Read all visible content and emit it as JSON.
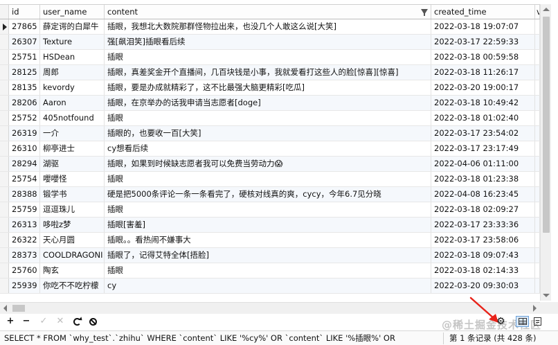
{
  "columns": {
    "id": "id",
    "user_name": "user_name",
    "content": "content",
    "created_time": "created_time",
    "extra": "v"
  },
  "rows": [
    {
      "id": "27865",
      "user_name": "薛定谔的白犀牛",
      "content": "插眼，我想北大数院那群怪物拉出来，也没几个人敢这么说[大笑]",
      "created_time": "2022-03-18 19:07:07"
    },
    {
      "id": "26307",
      "user_name": "Texture",
      "content": "强[飙泪笑]插眼看后续",
      "created_time": "2022-03-17 22:59:33"
    },
    {
      "id": "25751",
      "user_name": "HSDean",
      "content": "插眼",
      "created_time": "2022-03-18 00:59:58"
    },
    {
      "id": "28125",
      "user_name": "周郎",
      "content": "插眼，真差奖金开个直播间，几百块钱是小事，我就爱看打这些人的脸[惊喜][惊喜]",
      "created_time": "2022-03-18 11:26:17"
    },
    {
      "id": "28135",
      "user_name": "kevordy",
      "content": "插眼，要是办成就精彩了，这不比最强大脑更精彩[吃瓜]",
      "created_time": "2022-03-20 19:00:17"
    },
    {
      "id": "28206",
      "user_name": "Aaron",
      "content": "插眼，在京举办的话我申请当志愿者[doge]",
      "created_time": "2022-03-18 10:49:42"
    },
    {
      "id": "25752",
      "user_name": "405notfound",
      "content": "插眼",
      "created_time": "2022-03-18 01:02:40"
    },
    {
      "id": "26319",
      "user_name": "一介",
      "content": "插眼的，也要收一百[大笑]",
      "created_time": "2022-03-17 23:54:02"
    },
    {
      "id": "26310",
      "user_name": "柳亭进士",
      "content": "cy想看后续",
      "created_time": "2022-03-17 23:17:49"
    },
    {
      "id": "28294",
      "user_name": "湖驱",
      "content": "插眼，如果到时候缺志愿者我可以免费当劳动力😱",
      "created_time": "2022-04-06 01:11:00"
    },
    {
      "id": "25754",
      "user_name": "嚶嚶怪",
      "content": "插眼",
      "created_time": "2022-03-18 01:23:38"
    },
    {
      "id": "28388",
      "user_name": "锻学书",
      "content": "硬是把5000条评论一条一条看完了，硬核对线真的爽，cycy，今年6.7见分晓",
      "created_time": "2022-04-08 16:23:45"
    },
    {
      "id": "25759",
      "user_name": "逗逗珠儿",
      "content": "插眼",
      "created_time": "2022-03-18 02:09:27"
    },
    {
      "id": "26313",
      "user_name": "哆啦z梦",
      "content": "插眼[害羞]",
      "created_time": "2022-03-17 23:33:36"
    },
    {
      "id": "26322",
      "user_name": "天心月圆",
      "content": "插眼。。看热闹不嫌事大",
      "created_time": "2022-03-17 23:58:06"
    },
    {
      "id": "28373",
      "user_name": "COOLDRAGONI",
      "content": "插眼了，记得艾特全体[捂脸]",
      "created_time": "2022-03-18 09:07:43"
    },
    {
      "id": "25760",
      "user_name": "陶玄",
      "content": "插眼",
      "created_time": "2022-03-18 02:14:33"
    },
    {
      "id": "25939",
      "user_name": "你吃不不吃柠檬",
      "content": "cy",
      "created_time": "2022-03-20 09:30:03"
    }
  ],
  "toolbar": {
    "add": "+",
    "remove": "−",
    "apply": "✓",
    "discard": "✕"
  },
  "icons": {
    "filter": "filter-icon",
    "gear": "gear-icon",
    "grid_view": "grid-view-icon",
    "form_view": "form-view-icon"
  },
  "status": {
    "sql": "SELECT * FROM `why_test`.`zhihu` WHERE `content` LIKE '%cy%' OR `content` LIKE '%插眼%' ORDER BY",
    "record": "第 1 条记录 (共 428 条)"
  },
  "watermark": "@稀土掘金技术社区",
  "colors": {
    "arrow": "#e8231a",
    "selected_view": "#dbe9f8"
  }
}
